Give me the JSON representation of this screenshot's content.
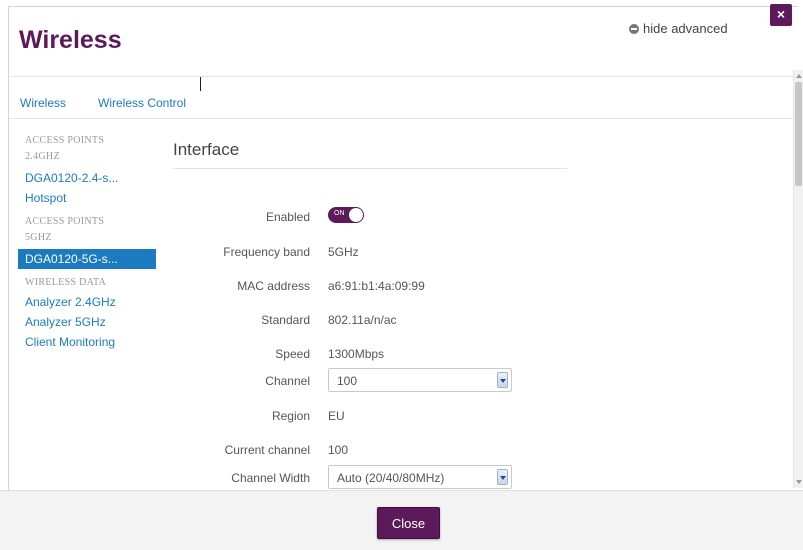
{
  "header": {
    "title": "Wireless",
    "hide_advanced": "hide advanced",
    "close_symbol": "×"
  },
  "tabs": [
    {
      "label": "Wireless"
    },
    {
      "label": "Wireless Control"
    }
  ],
  "sidebar": {
    "groups": [
      {
        "heading_line1": "ACCESS POINTS",
        "heading_line2": "2.4GHZ",
        "items": [
          "DGA0120-2.4-s...",
          "Hotspot"
        ]
      },
      {
        "heading_line1": "ACCESS POINTS",
        "heading_line2": "5GHZ",
        "items": [
          "DGA0120-5G-s..."
        ]
      },
      {
        "heading_line1": "WIRELESS DATA",
        "items": [
          "Analyzer 2.4GHz",
          "Analyzer 5GHz",
          "Client Monitoring"
        ]
      }
    ],
    "active_item": "DGA0120-5G-s..."
  },
  "section": {
    "title": "Interface"
  },
  "fields": {
    "enabled": {
      "label": "Enabled",
      "toggle_text": "ON"
    },
    "frequency_band": {
      "label": "Frequency band",
      "value": "5GHz"
    },
    "mac_address": {
      "label": "MAC address",
      "value": "a6:91:b1:4a:09:99"
    },
    "standard": {
      "label": "Standard",
      "value": "802.11a/n/ac"
    },
    "speed": {
      "label": "Speed",
      "value": "1300Mbps"
    },
    "channel": {
      "label": "Channel",
      "value": "100"
    },
    "region": {
      "label": "Region",
      "value": "EU"
    },
    "current_channel": {
      "label": "Current channel",
      "value": "100"
    },
    "channel_width": {
      "label": "Channel Width",
      "value": "Auto (20/40/80MHz)"
    }
  },
  "footer": {
    "close_label": "Close"
  },
  "colors": {
    "brand": "#5c1a5b",
    "link": "#1c7bbf"
  }
}
